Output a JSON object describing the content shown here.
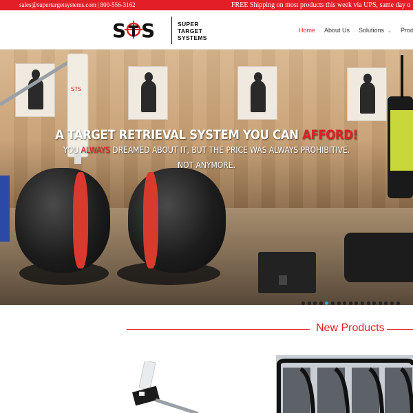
{
  "topbar": {
    "email": "sales@supertargetsystems.com",
    "separator": "|",
    "phone": "800-556-3162",
    "promo": "FREE Shipping on most products this week via UPS, same day o"
  },
  "logo": {
    "mark": "STS",
    "line1": "SUPER",
    "line2": "TARGET",
    "line3": "SYSTEMS"
  },
  "nav": {
    "items": [
      {
        "label": "Home",
        "active": true
      },
      {
        "label": "About Us",
        "active": false
      },
      {
        "label": "Solutions",
        "active": false,
        "dropdown": true
      },
      {
        "label": "Prod",
        "active": false
      }
    ]
  },
  "hero": {
    "headline_pre": "A TARGET RETRIEVAL SYSTEM YOU CAN ",
    "headline_highlight": "AFFORD!",
    "sub_pre": "YOU ",
    "sub_highlight": "ALWAYS",
    "sub_post": " DREAMED ABOUT IT, BUT THE PRICE WAS ALWAYS PROHIBITIVE.",
    "sub_line2": "NOT ANYMORE.",
    "slides": {
      "count": 17,
      "active_index": 4
    }
  },
  "section": {
    "title": "New Products"
  },
  "colors": {
    "brand_red": "#e41e26",
    "dot_active": "#29a9c7"
  }
}
